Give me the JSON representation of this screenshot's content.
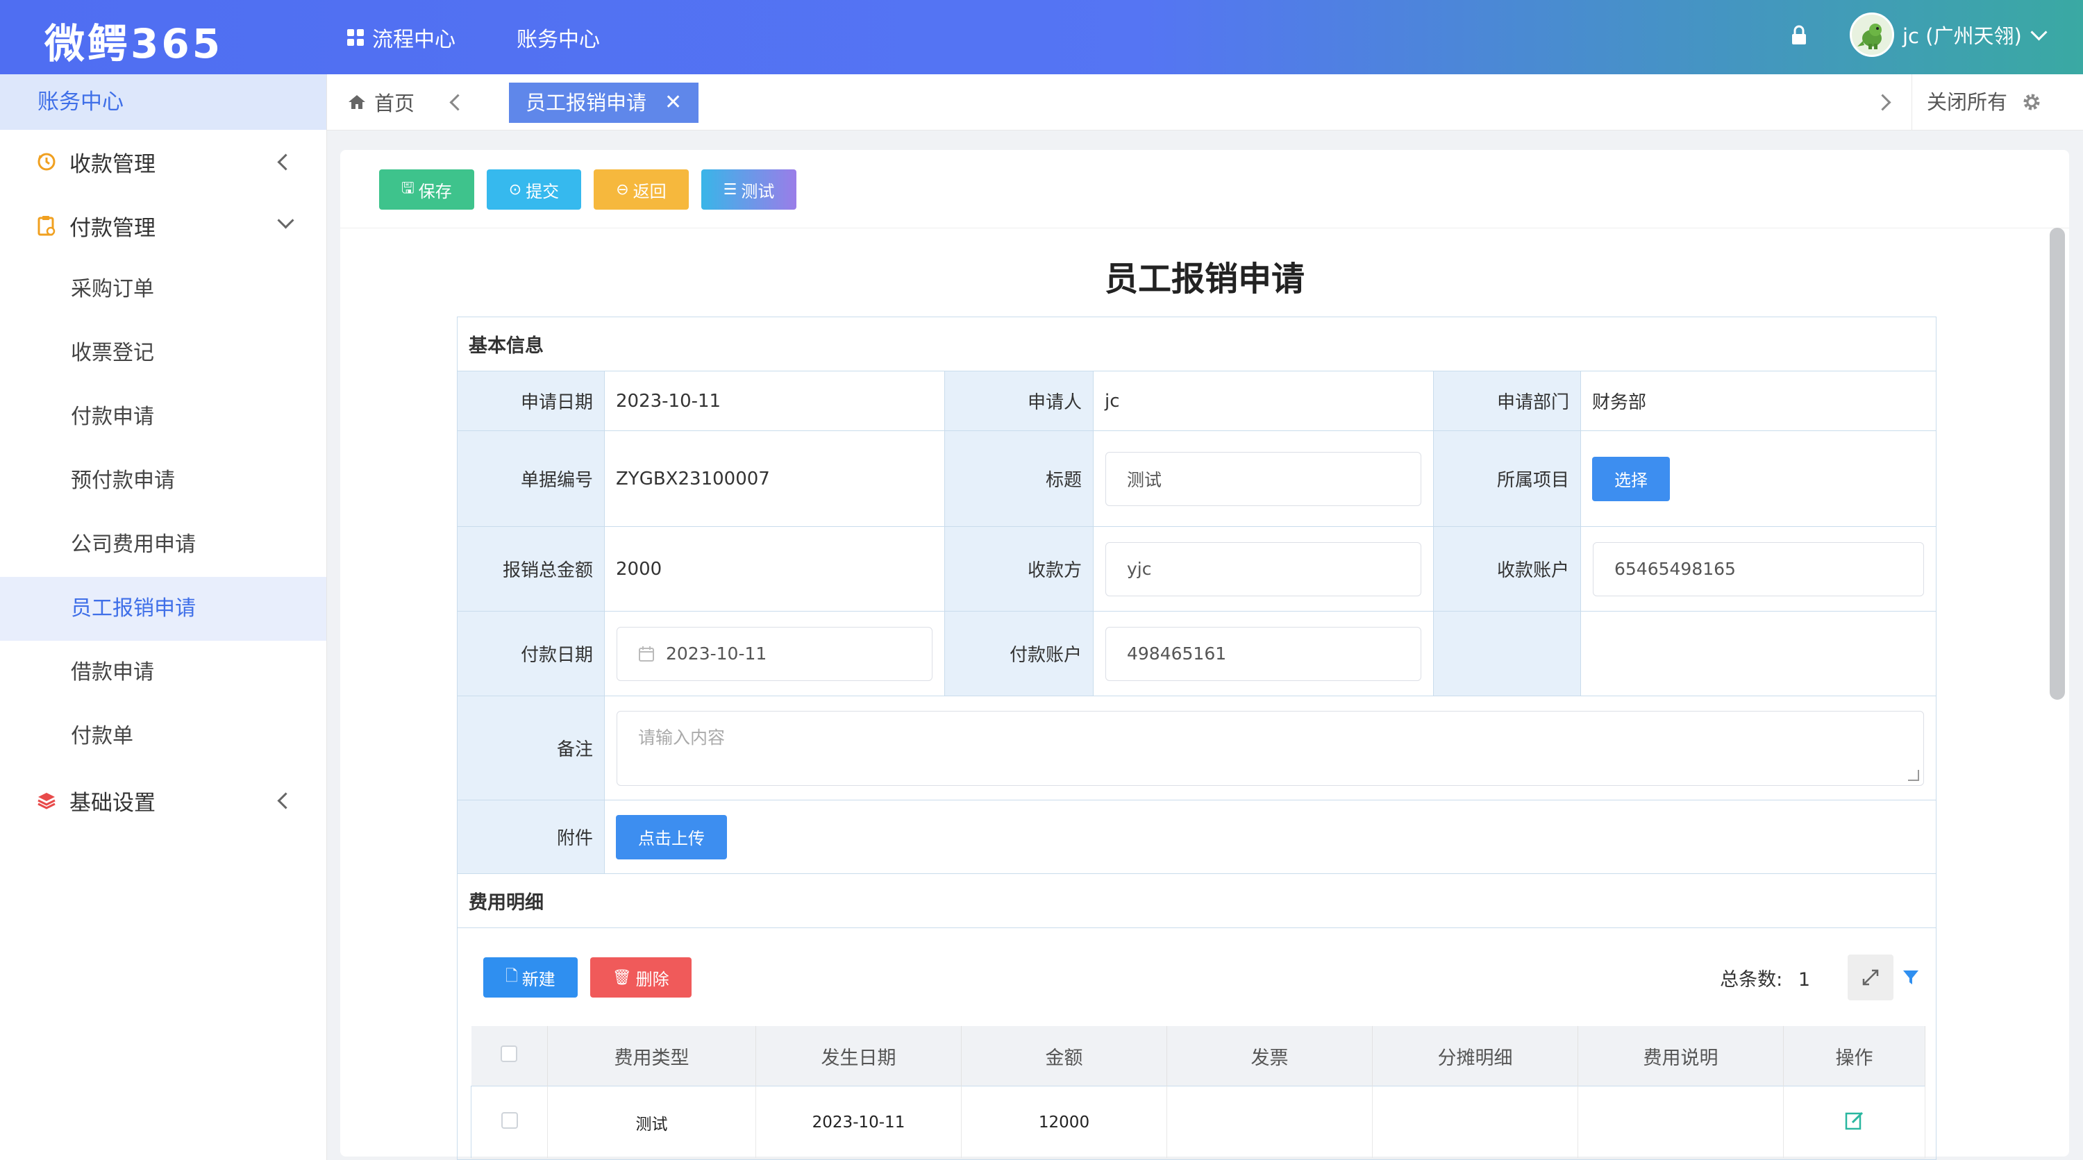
{
  "header": {
    "brand": "微鳄365",
    "nav": [
      {
        "label": "流程中心",
        "icon": "grid-icon"
      },
      {
        "label": "账务中心"
      }
    ],
    "user": "jc (广州天翎)",
    "colors": {
      "header_start": "#4f6ef2",
      "header_end": "#3aa9a3",
      "accent": "#3f6fe8"
    }
  },
  "sidebar": {
    "title": "账务中心",
    "groups": [
      {
        "label": "收款管理",
        "icon": "refund-icon",
        "expanded": false
      },
      {
        "label": "付款管理",
        "icon": "clipboard-icon",
        "expanded": true
      },
      {
        "label": "基础设置",
        "icon": "layers-icon",
        "expanded": false
      }
    ],
    "items": [
      "采购订单",
      "收票登记",
      "付款申请",
      "预付款申请",
      "公司费用申请",
      "员工报销申请",
      "借款申请",
      "付款单"
    ],
    "active_item": "员工报销申请"
  },
  "tabs": {
    "home": "首页",
    "active": "员工报销申请",
    "close_all": "关闭所有"
  },
  "toolbar": {
    "save": "保存",
    "submit": "提交",
    "back": "返回",
    "test": "测试"
  },
  "form": {
    "title": "员工报销申请",
    "basic_section": "基本信息",
    "fields": {
      "apply_date_label": "申请日期",
      "apply_date": "2023-10-11",
      "applicant_label": "申请人",
      "applicant": "jc",
      "department_label": "申请部门",
      "department": "财务部",
      "doc_no_label": "单据编号",
      "doc_no": "ZYGBX23100007",
      "title_label": "标题",
      "title_value": "测试",
      "project_label": "所属项目",
      "project_button": "选择",
      "total_label": "报销总金额",
      "total": "2000",
      "payee_label": "收款方",
      "payee": "yjc",
      "payee_account_label": "收款账户",
      "payee_account": "65465498165",
      "pay_date_label": "付款日期",
      "pay_date": "2023-10-11",
      "pay_account_label": "付款账户",
      "pay_account": "498465161",
      "remark_label": "备注",
      "remark_placeholder": "请输入内容",
      "attachment_label": "附件",
      "upload_button": "点击上传"
    },
    "detail_section": "费用明细",
    "detail_toolbar": {
      "new": "新建",
      "delete": "删除",
      "total_label": "总条数:",
      "total_count": "1"
    },
    "detail_columns": [
      "费用类型",
      "发生日期",
      "金额",
      "发票",
      "分摊明细",
      "费用说明",
      "操作"
    ],
    "detail_rows": [
      {
        "type": "测试",
        "date": "2023-10-11",
        "amount": "12000",
        "invoice": "",
        "allocation": "",
        "description": ""
      }
    ]
  }
}
